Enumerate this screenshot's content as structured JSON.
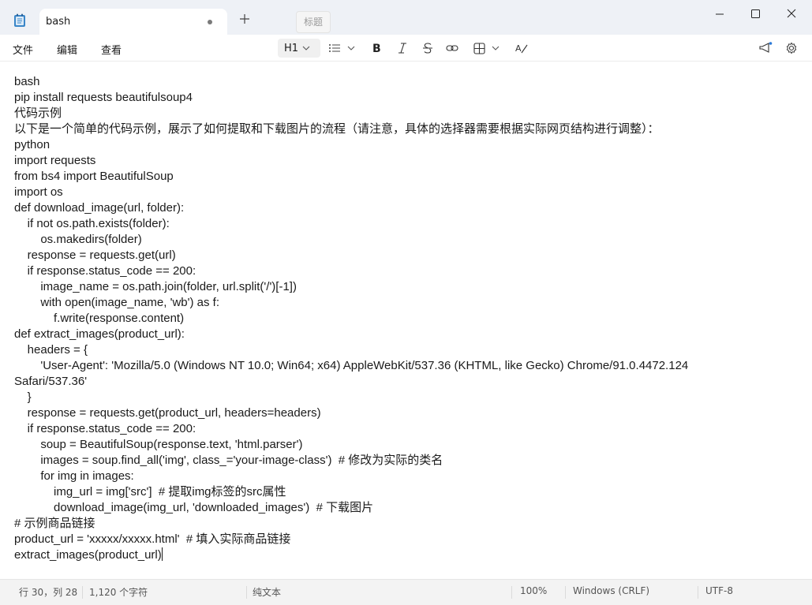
{
  "tab": {
    "title": "bash"
  },
  "tooltip": "标题",
  "menu": {
    "file": "文件",
    "edit": "编辑",
    "view": "查看"
  },
  "toolbar": {
    "heading": "H1"
  },
  "editor": {
    "lines": [
      "bash",
      "pip install requests beautifulsoup4",
      "代码示例",
      "以下是一个简单的代码示例，展示了如何提取和下载图片的流程（请注意，具体的选择器需要根据实际网页结构进行调整）：",
      "python",
      "import requests",
      "from bs4 import BeautifulSoup",
      "import os",
      "def download_image(url, folder):",
      "    if not os.path.exists(folder):",
      "        os.makedirs(folder)",
      "    response = requests.get(url)",
      "    if response.status_code == 200:",
      "        image_name = os.path.join(folder, url.split('/')[-1])",
      "        with open(image_name, 'wb') as f:",
      "            f.write(response.content)",
      "def extract_images(product_url):",
      "    headers = {",
      "        'User-Agent': 'Mozilla/5.0 (Windows NT 10.0; Win64; x64) AppleWebKit/537.36 (KHTML, like Gecko) Chrome/91.0.4472.124",
      "Safari/537.36'",
      "    }",
      "    response = requests.get(product_url, headers=headers)",
      "    if response.status_code == 200:",
      "        soup = BeautifulSoup(response.text, 'html.parser')",
      "        images = soup.find_all('img', class_='your-image-class')  # 修改为实际的类名",
      "        for img in images:",
      "            img_url = img['src']  # 提取img标签的src属性",
      "            download_image(img_url, 'downloaded_images')  # 下载图片",
      "# 示例商品链接",
      "product_url = 'xxxxx/xxxxx.html'  # 填入实际商品链接",
      "extract_images(product_url)"
    ]
  },
  "status": {
    "position": "行 30，列 28",
    "chars": "1,120 个字符",
    "format": "纯文本",
    "zoom": "100%",
    "line_ending": "Windows (CRLF)",
    "encoding": "UTF-8"
  }
}
